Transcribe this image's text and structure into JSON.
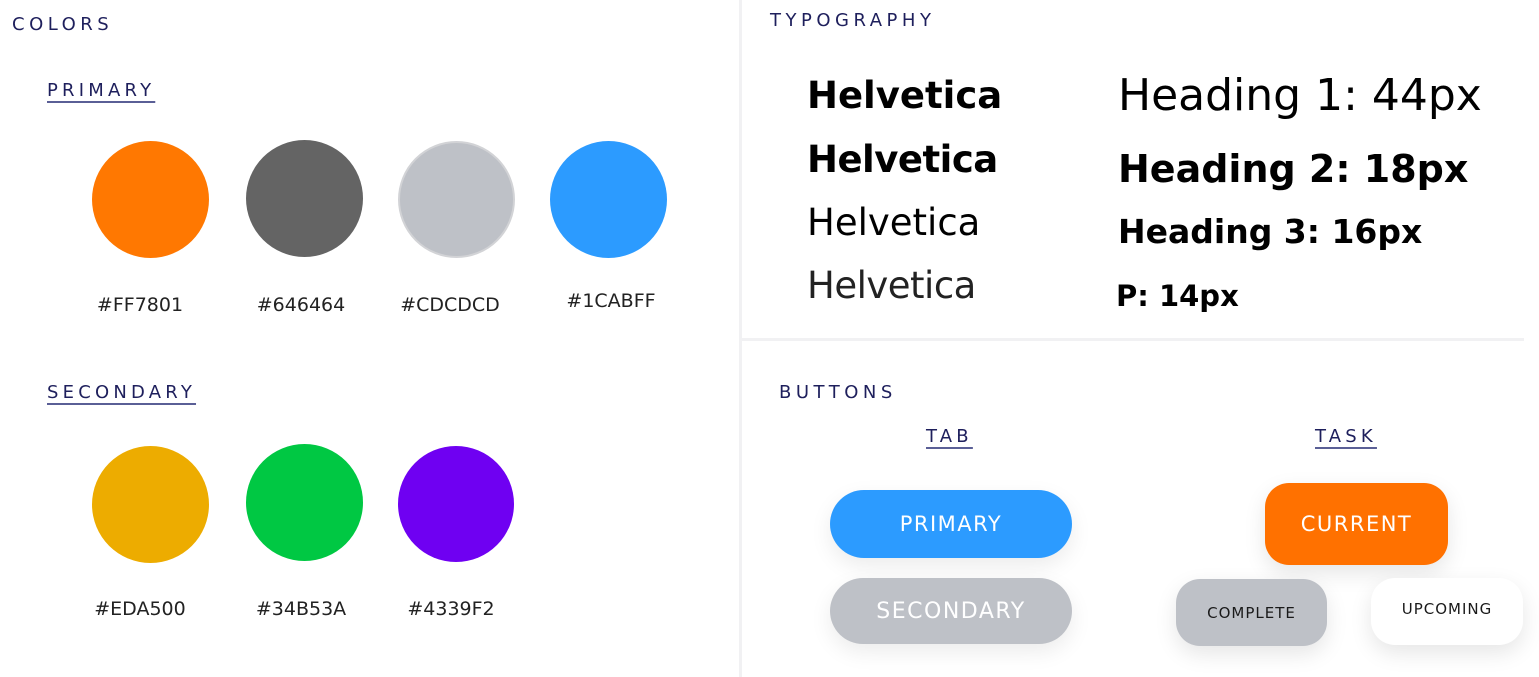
{
  "colors": {
    "title": "COLORS",
    "primary": {
      "title": "PRIMARY",
      "swatches": [
        {
          "hex": "#FF7801",
          "label": "#FF7801"
        },
        {
          "hex": "#646464",
          "label": "#646464"
        },
        {
          "hex": "#BEC1C7",
          "label": "#CDCDCD"
        },
        {
          "hex": "#2C9BFF",
          "label": "#1CABFF"
        }
      ]
    },
    "secondary": {
      "title": "SECONDARY",
      "swatches": [
        {
          "hex": "#EDAC00",
          "label": "#EDA500"
        },
        {
          "hex": "#00C843",
          "label": "#34B53A"
        },
        {
          "hex": "#6F00F2",
          "label": "#4339F2"
        }
      ]
    }
  },
  "typography": {
    "title": "TYPOGRAPHY",
    "fonts": [
      "Helvetica",
      "Helvetica",
      "Helvetica",
      "Helvetica"
    ],
    "sizes": [
      "Heading 1: 44px",
      "Heading 2: 18px",
      "Heading 3: 16px",
      "P: 14px"
    ]
  },
  "buttons": {
    "title": "BUTTONS",
    "tab": {
      "title": "TAB",
      "primary_label": "PRIMARY",
      "secondary_label": "SECONDARY",
      "primary_color": "#2C9BFF",
      "secondary_color": "#BEC1C7"
    },
    "task": {
      "title": "TASK",
      "current_label": "CURRENT",
      "complete_label": "COMPLETE",
      "upcoming_label": "UPCOMING",
      "current_color": "#FF7100",
      "complete_color": "#BEC1C7",
      "upcoming_color": "#FFFFFF"
    }
  }
}
